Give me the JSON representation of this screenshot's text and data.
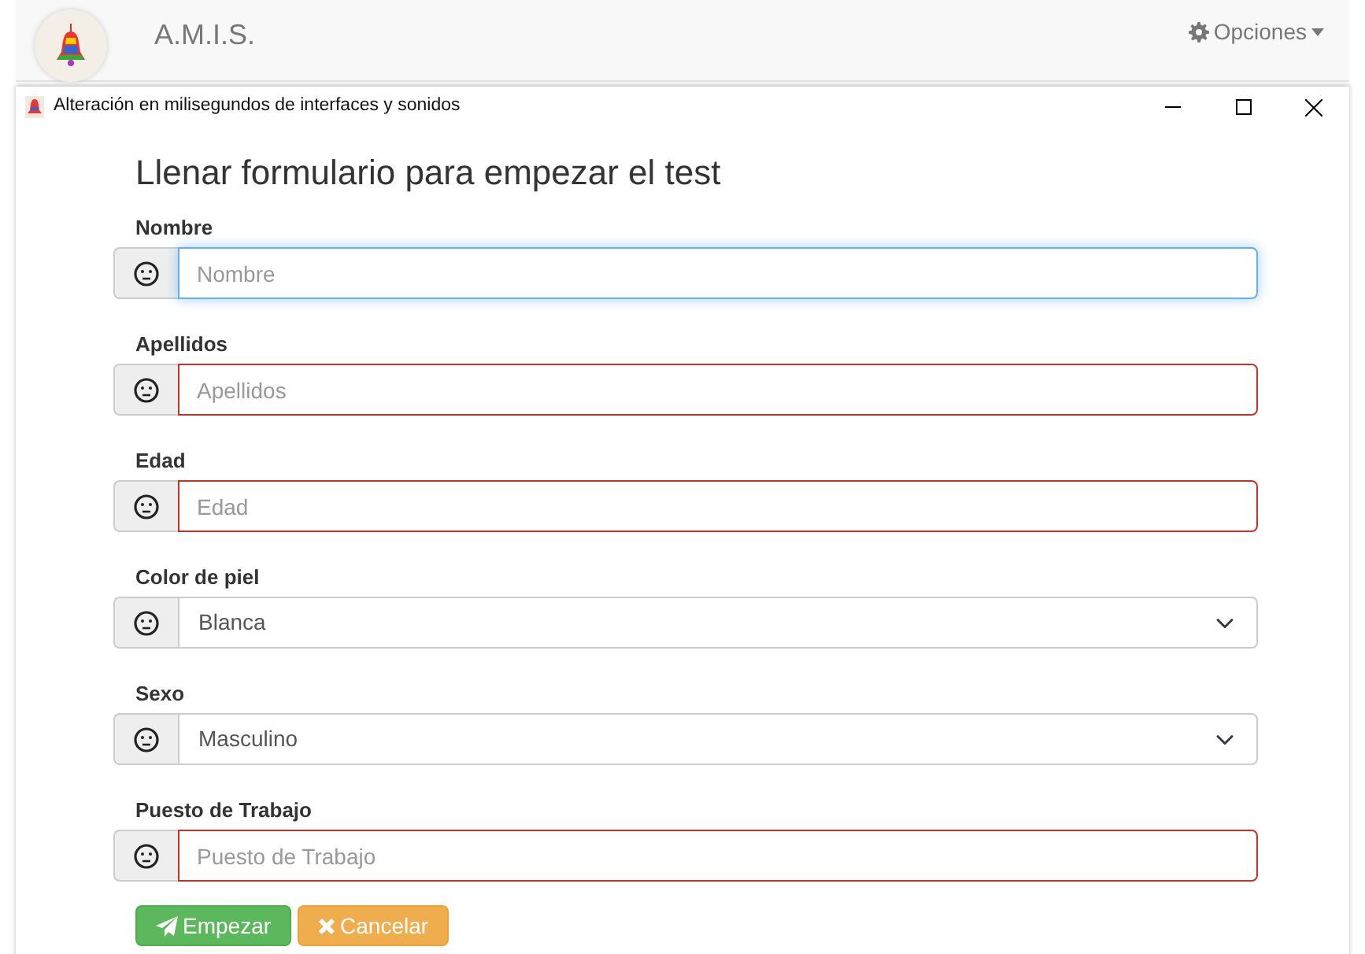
{
  "app_navbar": {
    "brand": "A.M.I.S.",
    "menu": {
      "label": "Opciones"
    }
  },
  "window": {
    "title": "Alteración en milisegundos de interfaces y sonidos"
  },
  "form": {
    "heading": "Llenar formulario para empezar el test",
    "fields": [
      {
        "kind": "text",
        "label": "Nombre",
        "placeholder": "Nombre",
        "focused": true,
        "error": false
      },
      {
        "kind": "text",
        "label": "Apellidos",
        "placeholder": "Apellidos",
        "focused": false,
        "error": true
      },
      {
        "kind": "text",
        "label": "Edad",
        "placeholder": "Edad",
        "focused": false,
        "error": true
      },
      {
        "kind": "select",
        "label": "Color de piel",
        "value": "Blanca",
        "focused": false,
        "error": false
      },
      {
        "kind": "select",
        "label": "Sexo",
        "value": "Masculino",
        "focused": false,
        "error": false
      },
      {
        "kind": "text",
        "label": "Puesto de Trabajo",
        "placeholder": "Puesto de Trabajo",
        "focused": false,
        "error": true
      }
    ],
    "buttons": [
      {
        "kind": "start",
        "label": "Empezar"
      },
      {
        "kind": "cancel",
        "label": "Cancelar"
      }
    ]
  }
}
